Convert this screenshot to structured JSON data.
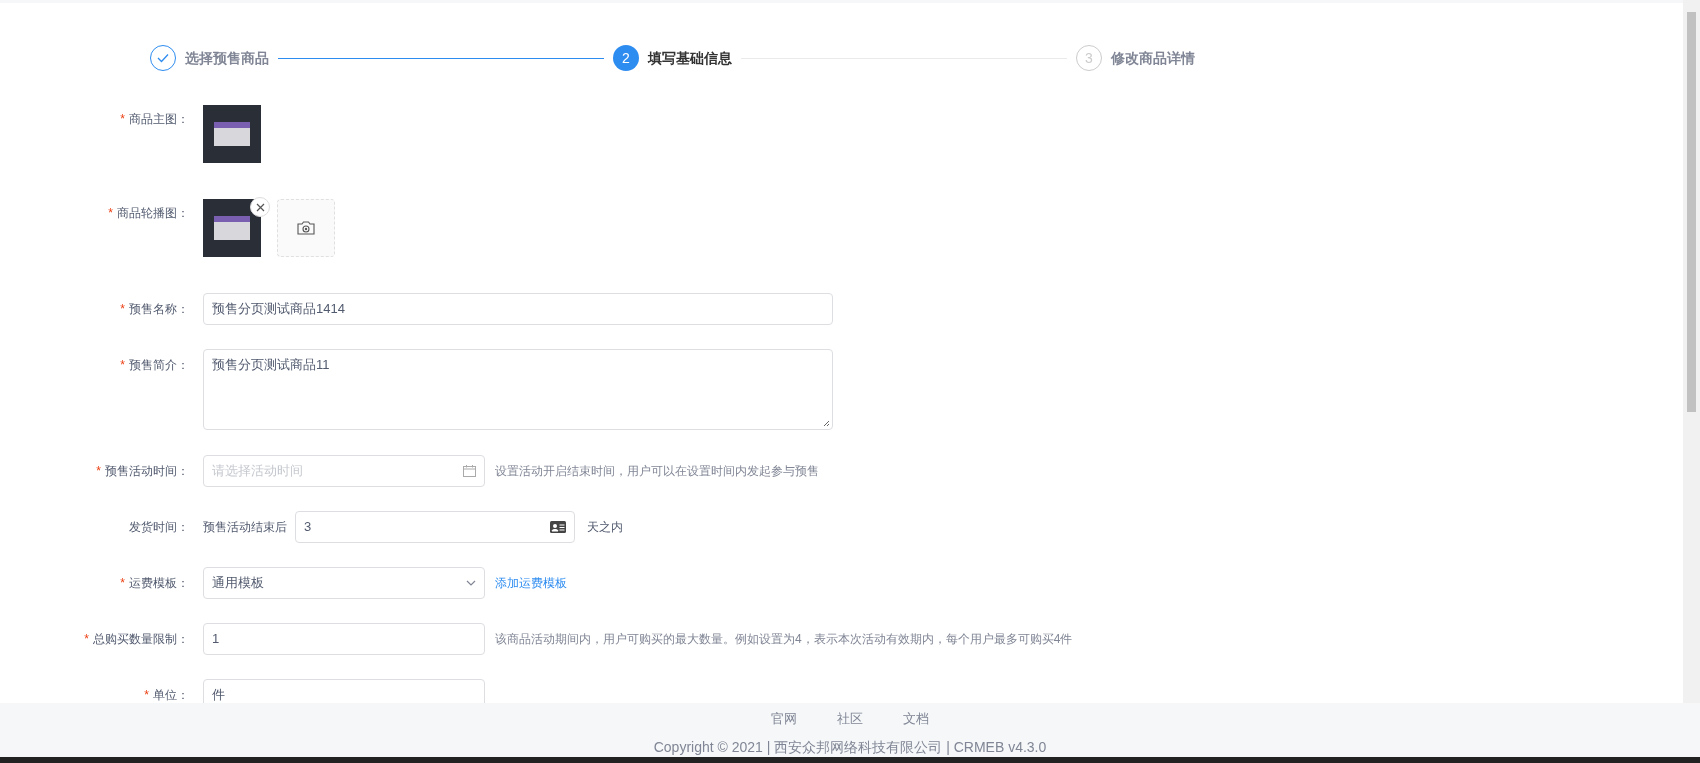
{
  "steps": [
    {
      "label": "选择预售商品",
      "done": true,
      "active": false
    },
    {
      "number": "2",
      "label": "填写基础信息",
      "done": false,
      "active": true
    },
    {
      "number": "3",
      "label": "修改商品详情",
      "done": false,
      "active": false
    }
  ],
  "form": [
    {
      "kind": "image",
      "mark": "*",
      "label": "商品主图：",
      "removable": false,
      "uploader": false
    },
    {
      "kind": "image",
      "mark": "*",
      "label": "商品轮播图：",
      "removable": true,
      "uploader": true
    },
    {
      "kind": "input",
      "mark": "*",
      "label": "预售名称：",
      "value": "预售分页测试商品1414"
    },
    {
      "kind": "textarea",
      "mark": "*",
      "label": "预售简介：",
      "value": "预售分页测试商品11"
    },
    {
      "kind": "date",
      "mark": "*",
      "label": "预售活动时间：",
      "placeholder": "请选择活动时间",
      "hint": "设置活动开启结束时间，用户可以在设置时间内发起参与预售"
    },
    {
      "kind": "ship",
      "label": "发货时间：",
      "prefix": "预售活动结束后",
      "value": "3",
      "suffix": "天之内"
    },
    {
      "kind": "select",
      "mark": "*",
      "label": "运费模板：",
      "value": "通用模板",
      "link": "添加运费模板"
    },
    {
      "kind": "short",
      "mark": "*",
      "label": "总购买数量限制：",
      "value": "1",
      "hint": "该商品活动期间内，用户可购买的最大数量。例如设置为4，表示本次活动有效期内，每个用户最多可购买4件"
    },
    {
      "kind": "short",
      "mark": "*",
      "label": "单位：",
      "value": "件"
    }
  ],
  "footer": {
    "links": [
      "官网",
      "社区",
      "文档"
    ],
    "copyright": "Copyright © 2021 | 西安众邦网络科技有限公司 | CRMEB v4.3.0"
  }
}
